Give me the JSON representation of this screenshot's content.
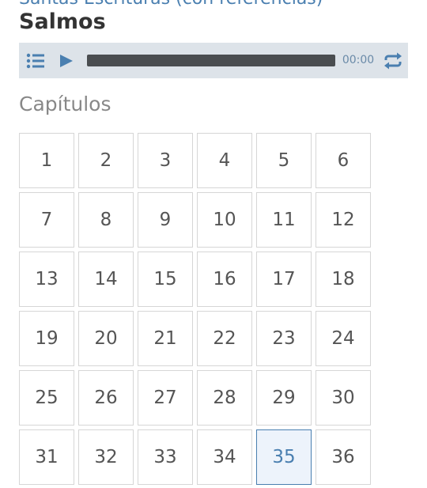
{
  "header": {
    "breadcrumb": "Santas Escrituras (con referencias)",
    "title": "Salmos"
  },
  "player": {
    "time": "00:00",
    "progress": 0,
    "icons": [
      "list-icon",
      "play-icon",
      "repeat-icon"
    ]
  },
  "chapters_section": {
    "label": "Capítulos",
    "selected": "35",
    "items": [
      "1",
      "2",
      "3",
      "4",
      "5",
      "6",
      "7",
      "8",
      "9",
      "10",
      "11",
      "12",
      "13",
      "14",
      "15",
      "16",
      "17",
      "18",
      "19",
      "20",
      "21",
      "22",
      "23",
      "24",
      "25",
      "26",
      "27",
      "28",
      "29",
      "30",
      "31",
      "32",
      "33",
      "34",
      "35",
      "36"
    ]
  },
  "colors": {
    "accent": "#4a7fb0",
    "player_bg": "#dde3e9",
    "selected_bg": "#edf3fb"
  }
}
